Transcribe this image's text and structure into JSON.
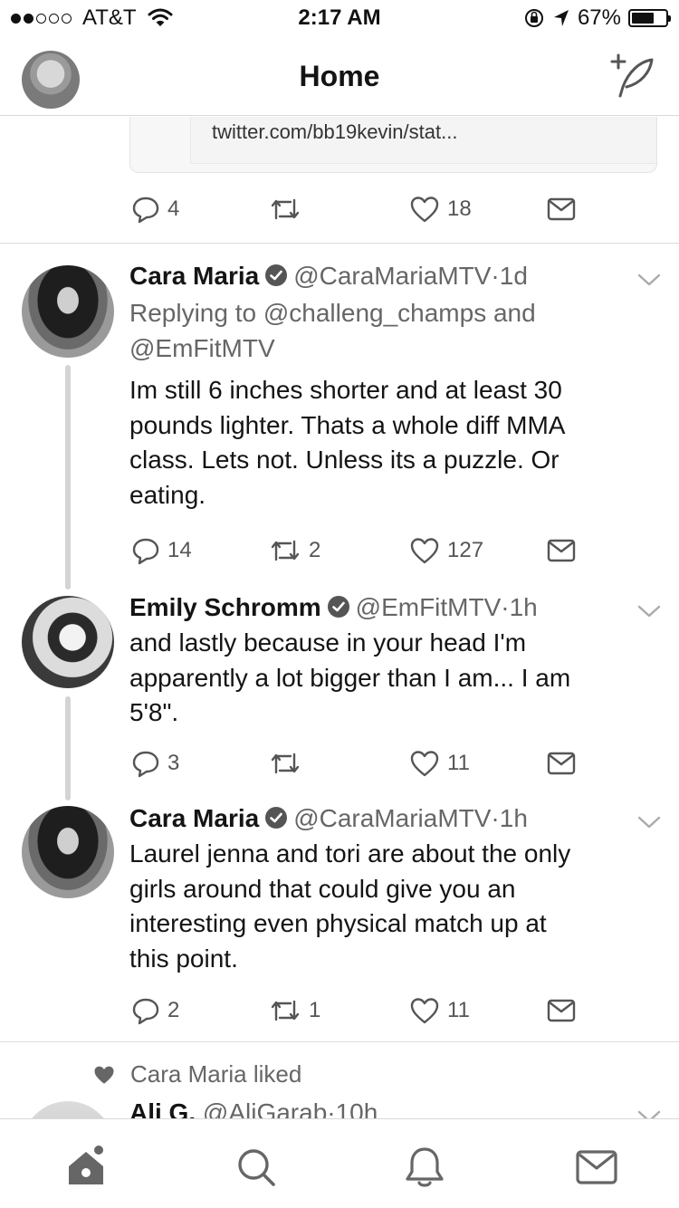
{
  "status_bar": {
    "carrier": "AT&T",
    "time": "2:17 AM",
    "battery_percent": "67%",
    "battery_level": 0.67,
    "signal_bars_filled": 2,
    "signal_bars_total": 5
  },
  "header": {
    "title": "Home"
  },
  "top_card": {
    "link_text": "twitter.com/bb19kevin/stat...",
    "replies": "4",
    "retweets": "",
    "likes": "18"
  },
  "tweets": [
    {
      "name": "Cara Maria",
      "handle": "@CaraMariaMTV",
      "separator": "·",
      "time": "1d",
      "replying_to_line1": "Replying to @challeng_champs and",
      "replying_to_line2": "@EmFitMTV",
      "text_lines": [
        "Im still 6 inches shorter and at least 30",
        "pounds lighter. Thats a whole diff MMA",
        "class. Lets not. Unless its a puzzle. Or",
        "eating."
      ],
      "replies": "14",
      "retweets": "2",
      "likes": "127"
    },
    {
      "name": "Emily Schromm",
      "handle": "@EmFitMTV",
      "separator": "·",
      "time": "1h",
      "text_lines": [
        "and lastly because in your head I'm",
        "apparently a lot bigger than I am... I am",
        "5'8\"."
      ],
      "replies": "3",
      "retweets": "",
      "likes": "11"
    },
    {
      "name": "Cara Maria",
      "handle": "@CaraMariaMTV",
      "separator": "·",
      "time": "1h",
      "text_lines": [
        "Laurel jenna and tori are about the only",
        "girls around that could give you an",
        "interesting even physical match up at",
        "this point."
      ],
      "replies": "2",
      "retweets": "1",
      "likes": "11"
    }
  ],
  "liked_notice": {
    "text": "Cara Maria liked"
  },
  "partial_tweet": {
    "name": "Ali G.",
    "handle": "@AliGarab",
    "separator": "·",
    "time": "10h"
  },
  "colors": {
    "text": "#141414",
    "secondary": "#666666",
    "divider": "#dcdcdc"
  }
}
